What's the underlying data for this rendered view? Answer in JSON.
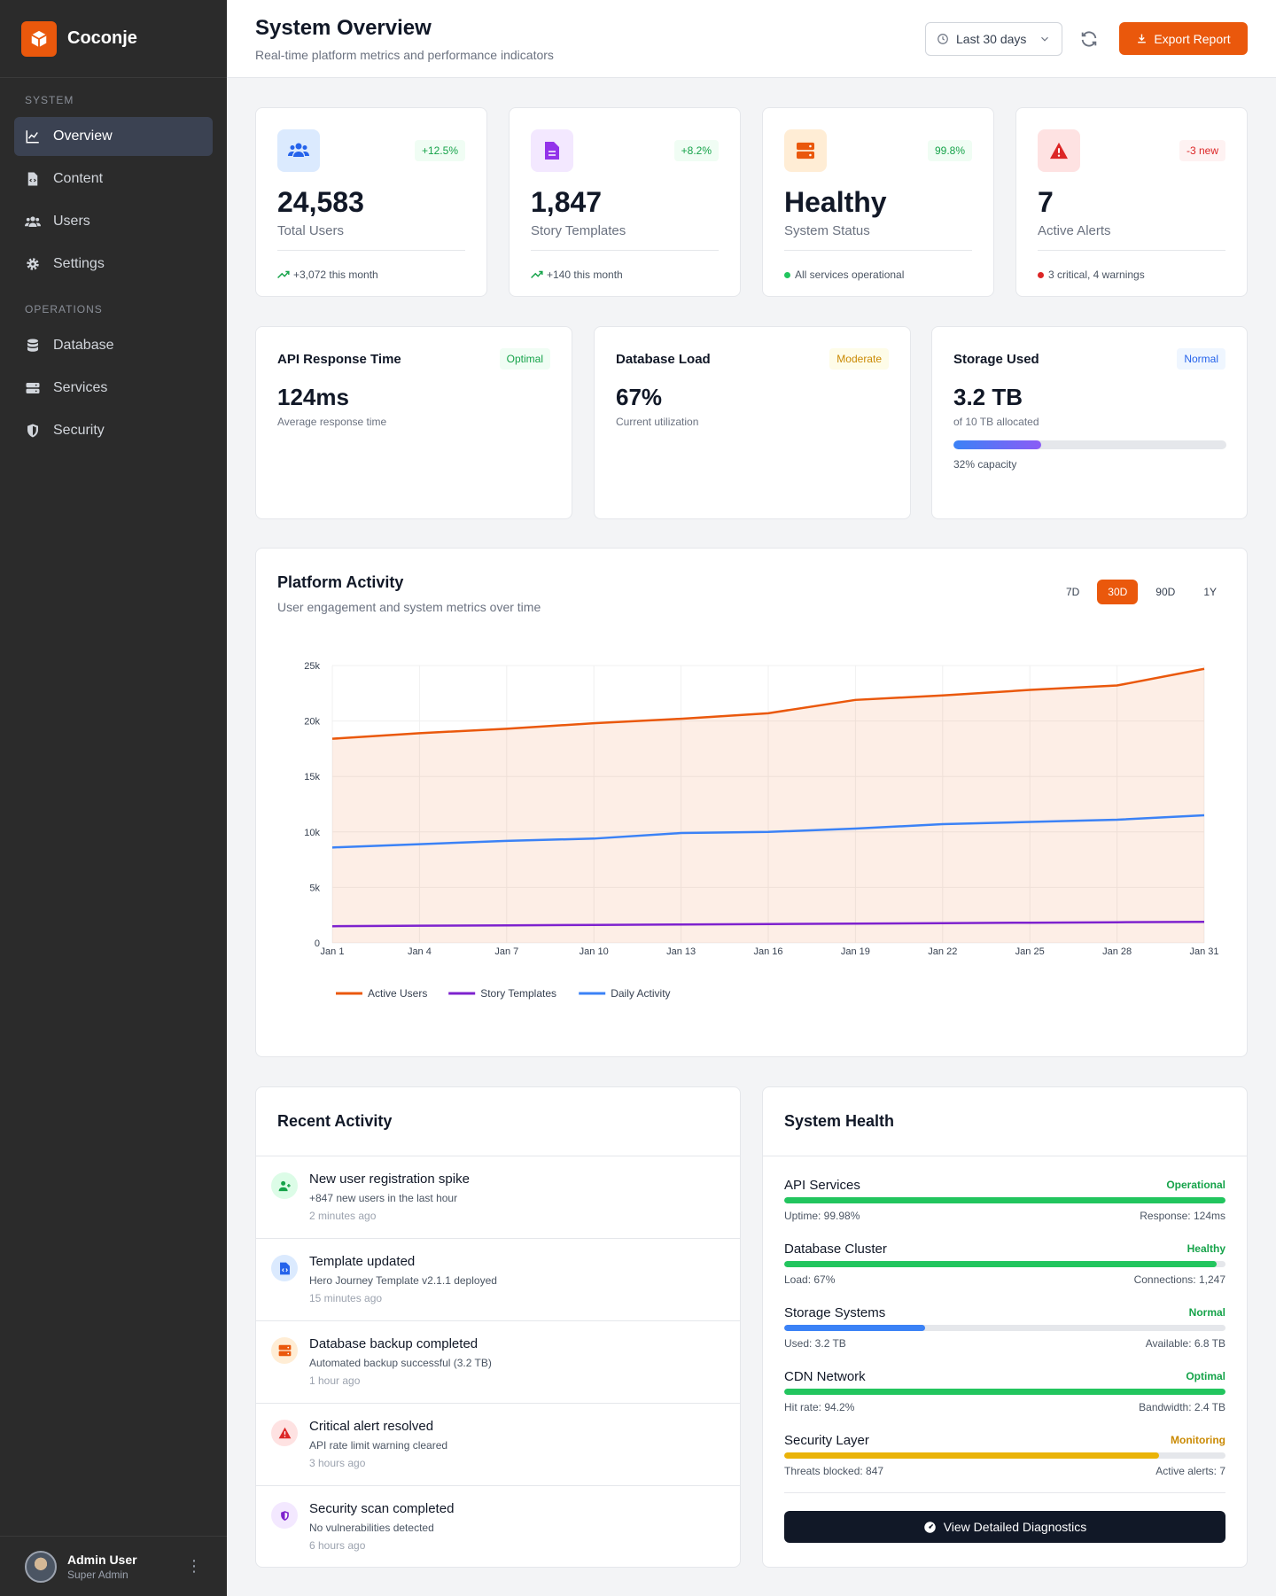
{
  "brand": {
    "name": "Coconje",
    "accent": "#ea580c"
  },
  "sidebar": {
    "sections": [
      {
        "title": "SYSTEM",
        "items": [
          {
            "label": "Overview",
            "icon": "chart-line-icon",
            "active": true
          },
          {
            "label": "Content",
            "icon": "file-code-icon"
          },
          {
            "label": "Users",
            "icon": "users-icon"
          },
          {
            "label": "Settings",
            "icon": "gear-icon"
          }
        ]
      },
      {
        "title": "OPERATIONS",
        "items": [
          {
            "label": "Database",
            "icon": "database-icon"
          },
          {
            "label": "Services",
            "icon": "server-icon"
          },
          {
            "label": "Security",
            "icon": "shield-icon"
          }
        ]
      }
    ],
    "user": {
      "name": "Admin User",
      "role": "Super Admin"
    }
  },
  "header": {
    "title": "System Overview",
    "subtitle": "Real-time platform metrics and performance indicators",
    "range_label": "Last 30 days",
    "export_label": "Export Report"
  },
  "stats": [
    {
      "value": "24,583",
      "label": "Total Users",
      "badge": "+12.5%",
      "foot": "+3,072 this month",
      "icon": "users-icon"
    },
    {
      "value": "1,847",
      "label": "Story Templates",
      "badge": "+8.2%",
      "foot": "+140 this month",
      "icon": "file-icon"
    },
    {
      "value": "Healthy",
      "label": "System Status",
      "badge": "99.8%",
      "foot": "All services operational",
      "icon": "server-icon"
    },
    {
      "value": "7",
      "label": "Active Alerts",
      "badge": "-3 new",
      "foot": "3 critical, 4 warnings",
      "icon": "warning-icon"
    }
  ],
  "metrics": [
    {
      "title": "API Response Time",
      "badge": "Optimal",
      "value": "124ms",
      "sub": "Average response time"
    },
    {
      "title": "Database Load",
      "badge": "Moderate",
      "value": "67%",
      "sub": "Current utilization"
    },
    {
      "title": "Storage Used",
      "badge": "Normal",
      "value": "3.2 TB",
      "sub": "of 10 TB allocated",
      "capacity": "32% capacity",
      "fill": 0.32
    }
  ],
  "chart": {
    "title": "Platform Activity",
    "subtitle": "User engagement and system metrics over time",
    "ranges": [
      "7D",
      "30D",
      "90D",
      "1Y"
    ],
    "active_range": "30D"
  },
  "chart_data": {
    "type": "line",
    "x": [
      "Jan 1",
      "Jan 4",
      "Jan 7",
      "Jan 10",
      "Jan 13",
      "Jan 16",
      "Jan 19",
      "Jan 22",
      "Jan 25",
      "Jan 28",
      "Jan 31"
    ],
    "y_ticks": [
      "0",
      "5k",
      "10k",
      "15k",
      "20k",
      "25k"
    ],
    "ylim": [
      0,
      25000
    ],
    "grid": true,
    "legend": "bottom-left",
    "series": [
      {
        "name": "Active Users",
        "color": "#ea580c",
        "fill": true,
        "values": [
          18400,
          18900,
          19300,
          19800,
          20200,
          20700,
          21900,
          22300,
          22800,
          23200,
          24700
        ]
      },
      {
        "name": "Story Templates",
        "color": "#7e22ce",
        "fill": false,
        "values": [
          1500,
          1550,
          1580,
          1620,
          1660,
          1700,
          1740,
          1780,
          1820,
          1860,
          1900
        ]
      },
      {
        "name": "Daily Activity",
        "color": "#3b82f6",
        "fill": false,
        "values": [
          8600,
          8900,
          9200,
          9400,
          9900,
          10000,
          10300,
          10700,
          10900,
          11100,
          11500
        ]
      }
    ]
  },
  "activity": {
    "title": "Recent Activity",
    "items": [
      {
        "title": "New user registration spike",
        "desc": "+847 new users in the last hour",
        "time": "2 minutes ago",
        "icon": "user-plus-icon",
        "bg": "#dcfce7",
        "fg": "#16a34a"
      },
      {
        "title": "Template updated",
        "desc": "Hero Journey Template v2.1.1 deployed",
        "time": "15 minutes ago",
        "icon": "file-code-icon",
        "bg": "#dbeafe",
        "fg": "#2563eb"
      },
      {
        "title": "Database backup completed",
        "desc": "Automated backup successful (3.2 TB)",
        "time": "1 hour ago",
        "icon": "server-icon",
        "bg": "#ffedd5",
        "fg": "#ea580c"
      },
      {
        "title": "Critical alert resolved",
        "desc": "API rate limit warning cleared",
        "time": "3 hours ago",
        "icon": "warning-icon",
        "bg": "#fee2e2",
        "fg": "#dc2626"
      },
      {
        "title": "Security scan completed",
        "desc": "No vulnerabilities detected",
        "time": "6 hours ago",
        "icon": "shield-icon",
        "bg": "#f3e8ff",
        "fg": "#7e22ce"
      }
    ]
  },
  "health": {
    "title": "System Health",
    "items": [
      {
        "name": "API Services",
        "status": "Operational",
        "left": "Uptime: 99.98%",
        "right": "Response: 124ms",
        "fill": 0.9998,
        "color": "#22c55e",
        "status_color": "#16a34a"
      },
      {
        "name": "Database Cluster",
        "status": "Healthy",
        "left": "Load: 67%",
        "right": "Connections: 1,247",
        "fill": 0.98,
        "color": "#22c55e",
        "status_color": "#16a34a"
      },
      {
        "name": "Storage Systems",
        "status": "Normal",
        "left": "Used: 3.2 TB",
        "right": "Available: 6.8 TB",
        "fill": 0.32,
        "color": "#3b82f6",
        "status_color": "#16a34a"
      },
      {
        "name": "CDN Network",
        "status": "Optimal",
        "left": "Hit rate: 94.2%",
        "right": "Bandwidth: 2.4 TB",
        "fill": 1.0,
        "color": "#22c55e",
        "status_color": "#16a34a"
      },
      {
        "name": "Security Layer",
        "status": "Monitoring",
        "left": "Threats blocked: 847",
        "right": "Active alerts: 7",
        "fill": 0.85,
        "color": "#eab308",
        "status_color": "#ca8a04"
      }
    ],
    "button_label": "View Detailed Diagnostics"
  }
}
